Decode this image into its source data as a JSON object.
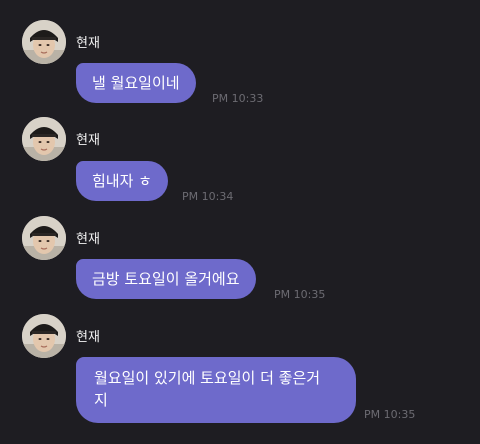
{
  "messages": [
    {
      "sender": "현재",
      "text": "낼 월요일이네",
      "time": "PM 10:33"
    },
    {
      "sender": "현재",
      "text": "힘내자 ㅎ",
      "time": "PM 10:34"
    },
    {
      "sender": "현재",
      "text": "금방 토요일이 올거에요",
      "time": "PM 10:35"
    },
    {
      "sender": "현재",
      "text": "월요일이 있기에 토요일이 더 좋은거\n지",
      "time": "PM 10:35"
    }
  ],
  "colors": {
    "background": "#1e1d22",
    "bubble": "#6e6acb",
    "bubble_text": "#ffffff",
    "sender_text": "#f2f2f2",
    "time_text": "#6c6b72"
  },
  "icons": {
    "avatar": "profile-photo-avatar"
  }
}
